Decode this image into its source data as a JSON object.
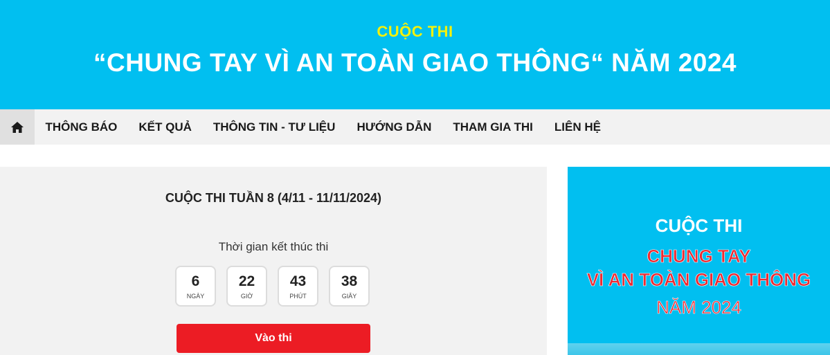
{
  "header": {
    "kicker": "CUỘC THI",
    "title": "“CHUNG TAY VÌ AN TOÀN GIAO THÔNG“ NĂM 2024"
  },
  "nav": {
    "home_icon": "home-icon",
    "items": [
      {
        "label": "THÔNG BÁO"
      },
      {
        "label": "KẾT QUẢ"
      },
      {
        "label": "THÔNG TIN - TƯ LIỆU"
      },
      {
        "label": "HƯỚNG DẪN"
      },
      {
        "label": "THAM GIA THI"
      },
      {
        "label": "LIÊN HỆ"
      }
    ]
  },
  "contest": {
    "title": "CUỘC THI TUẦN 8 (4/11 - 11/11/2024)",
    "ends_label": "Thời gian kết thúc thi",
    "countdown": [
      {
        "value": "6",
        "unit": "NGÀY"
      },
      {
        "value": "22",
        "unit": "GIỜ"
      },
      {
        "value": "43",
        "unit": "PHÚT"
      },
      {
        "value": "38",
        "unit": "GIÂY"
      }
    ],
    "enter_label": "Vào thi"
  },
  "banner": {
    "line1": "CUỘC THI",
    "line2": "CHUNG TAY",
    "line3": "VÌ AN TOÀN GIAO THÔNG",
    "line4": "NĂM 2024"
  },
  "colors": {
    "brand": "#01bff0",
    "accent_yellow": "#f5f10b",
    "button_red": "#ec1c24",
    "banner_red": "#ee2a32"
  }
}
